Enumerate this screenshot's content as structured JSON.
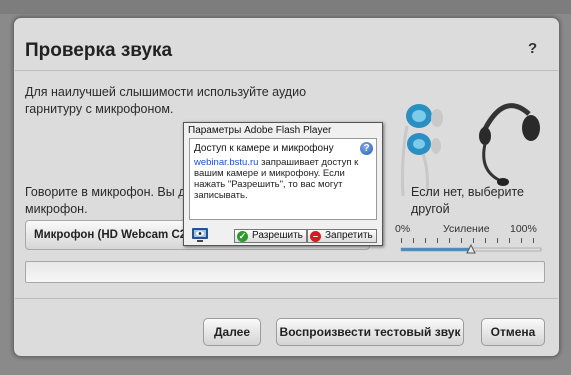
{
  "dialog": {
    "title": "Проверка звука",
    "help": "?",
    "intro": "Для наилучшей слышимости используйте аудио гарнитуру с микрофоном.",
    "speak_left": "Говорите в микрофон. Вы дол",
    "speak_right": "Если нет, выберите другой",
    "speak_line2": "микрофон.",
    "mic_select_value": "Микрофон (HD Webcam C270",
    "gain": {
      "min_label": "0%",
      "label": "Усиление",
      "max_label": "100%",
      "level": 0.5
    },
    "buttons": {
      "next": "Далее",
      "play_test": "Воспроизвести тестовый звук",
      "cancel": "Отмена"
    }
  },
  "flash_panel": {
    "title": "Параметры Adobe Flash Player",
    "heading": "Доступ к камере и микрофону",
    "help": "?",
    "site": "webinar.bstu.ru",
    "message": " запрашивает доступ к вашим камере и микрофону. Если нажать \"Разрешить\", то вас могут записывать.",
    "allow": "Разрешить",
    "deny": "Запретить"
  },
  "colors": {
    "link": "#1a4fd6",
    "allow_icon": "#2e9a2e",
    "deny_icon": "#d21e1e",
    "slider_track": "#3a8fd0"
  }
}
